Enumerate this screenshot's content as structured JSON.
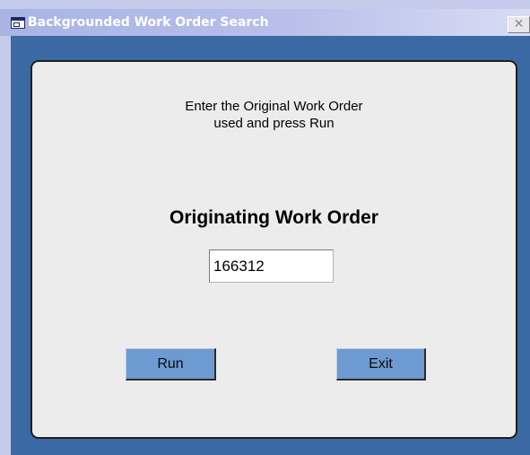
{
  "window": {
    "title": "Backgrounded Work Order Search",
    "close_glyph": "✕",
    "icon": "form-window-icon"
  },
  "form": {
    "instructions_line1": "Enter the Original Work Order",
    "instructions_line2": "used and press Run",
    "field_label": "Originating Work Order",
    "work_order_value": "166312"
  },
  "buttons": {
    "run_label": "Run",
    "exit_label": "Exit"
  },
  "colors": {
    "client_background": "#3b69a4",
    "panel_background": "#ececec",
    "button_face": "#6d9ad0",
    "title_text": "#ffffff"
  }
}
